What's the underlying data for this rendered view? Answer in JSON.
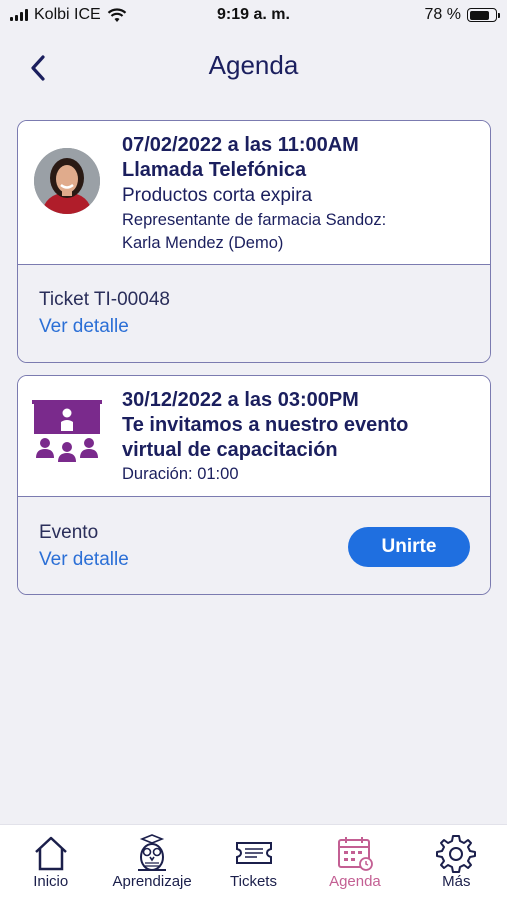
{
  "status_bar": {
    "carrier": "Kolbi ICE",
    "time": "9:19 a. m.",
    "battery_percent": "78 %",
    "battery_level": 0.78
  },
  "header": {
    "title": "Agenda"
  },
  "cards": [
    {
      "date": "07/02/2022 a las 11:00AM",
      "title": "Llamada Telefónica",
      "subtitle": "Productos corta expira",
      "detail": "Representante de farmacia Sandoz:",
      "detail2": "Karla Mendez (Demo)",
      "type": "Ticket TI-00048",
      "link": "Ver detalle"
    },
    {
      "date": "30/12/2022 a las 03:00PM",
      "title_line1": "Te invitamos a nuestro evento",
      "title_line2": "virtual de capacitación",
      "duration": "Duración: 01:00",
      "type": "Evento",
      "link": "Ver detalle",
      "button": "Unirte"
    }
  ],
  "tab_bar": {
    "items": [
      {
        "label": "Inicio",
        "icon": "home-icon"
      },
      {
        "label": "Aprendizaje",
        "icon": "owl-icon"
      },
      {
        "label": "Tickets",
        "icon": "ticket-icon"
      },
      {
        "label": "Agenda",
        "icon": "calendar-icon",
        "active": true
      },
      {
        "label": "Más",
        "icon": "gear-icon"
      }
    ]
  },
  "colors": {
    "primary": "#1b1f5e",
    "accent": "#1f6fe0",
    "link": "#2b6fd6",
    "active_tab": "#c35f93",
    "event_icon": "#7a2a8c"
  }
}
